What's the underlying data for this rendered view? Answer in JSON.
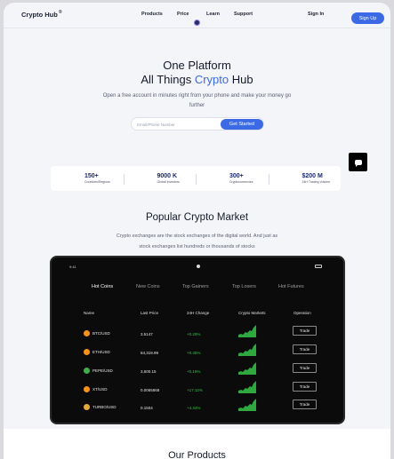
{
  "nav": {
    "logo": "Crypto Hub",
    "logo_mark": "®",
    "links": [
      "Products",
      "Price",
      "Learn",
      "Support"
    ],
    "signin": "Sign In",
    "signup": "Sign Up"
  },
  "hero": {
    "title_line1": "One Platform",
    "title_line2_pre": "All Things ",
    "title_line2_accent": "Crypto",
    "title_line2_post": " Hub",
    "subtitle": "Open a free account in minutes right from your phone and make your money go further",
    "email_placeholder": "Email/Phone Number",
    "cta": "Get Started"
  },
  "stats": [
    {
      "value": "150+",
      "label": "Countries/Regions"
    },
    {
      "value": "9000 K",
      "label": "Global Investors"
    },
    {
      "value": "300+",
      "label": "Cryptocurrencies"
    },
    {
      "value": "$200 M",
      "label": "24H Trading Volume"
    }
  ],
  "market": {
    "title": "Popular Crypto Market",
    "subtitle": "Crypto exchanges are the stock exchanges of the digital world. And just as stock exchanges list hundreds or thousands of stocks",
    "status_time": "9:41",
    "tabs": [
      "Hot Coins",
      "New Coins",
      "Top Gainers",
      "Top Losers",
      "Hot Futures"
    ],
    "active_tab": "Hot Coins",
    "columns": [
      "Name",
      "Last Price",
      "24H Change",
      "Crypto Markets",
      "Operation"
    ],
    "rows": [
      {
        "name": "BTC/USD",
        "price": "3.5147",
        "change": "+0.29%",
        "trade": "Trade",
        "color": "#f7931a"
      },
      {
        "name": "ETH/USD",
        "price": "84,319.99",
        "change": "+0.45%",
        "trade": "Trade",
        "color": "#f7931a"
      },
      {
        "name": "PEPE/USD",
        "price": "3,500.15",
        "change": "+0.19%",
        "trade": "Trade",
        "color": "#3fae4a"
      },
      {
        "name": "XT/USD",
        "price": "0.0065868",
        "change": "+17.12%",
        "trade": "Trade",
        "color": "#f7931a"
      },
      {
        "name": "TURBO/USD",
        "price": "0.1504",
        "change": "+4.44%",
        "trade": "Trade",
        "color": "#e3a93c"
      }
    ]
  },
  "products": {
    "title": "Our Products"
  },
  "colors": {
    "accent": "#3c6ae6",
    "positive": "#36c04a",
    "dark": "#0b0b0b"
  }
}
